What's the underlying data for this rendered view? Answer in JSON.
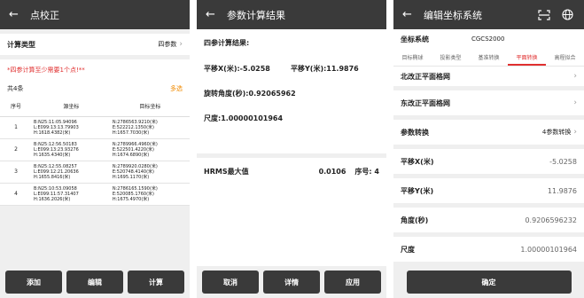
{
  "panel1": {
    "title": "点校正",
    "calc_type_label": "计算类型",
    "calc_type_value": "四参数",
    "warning": "*四参计算至少需要1个点!**",
    "count": "共4条",
    "multiselect": "多选",
    "columns": [
      "序号",
      "源坐标",
      "目标坐标"
    ],
    "rows": [
      {
        "num": "1",
        "src1": "B:N25:11:05.94096",
        "src2": "L:E099:13:13.79903",
        "src3": "H:1618.4382(米)",
        "dst1": "N:2786563.9210(米)",
        "dst2": "E:522212.1350(米)",
        "dst3": "H:1657.7030(米)"
      },
      {
        "num": "2",
        "src1": "B:N25:12:56.50183",
        "src2": "L:E099:13:23.93276",
        "src3": "H:1635.4340(米)",
        "dst1": "N:2789966.4960(米)",
        "dst2": "E:522501.4220(米)",
        "dst3": "H:1674.6890(米)"
      },
      {
        "num": "3",
        "src1": "B:N25:12:55.08257",
        "src2": "L:E099:12:21.20636",
        "src3": "H:1655.8416(米)",
        "dst1": "N:2789920.0280(米)",
        "dst2": "E:520748.4140(米)",
        "dst3": "H:1695.1170(米)"
      },
      {
        "num": "4",
        "src1": "B:N25:10:53.09058",
        "src2": "L:E099:11:57.31407",
        "src3": "H:1636.2026(米)",
        "dst1": "N:2786165.1590(米)",
        "dst2": "E:520085.1760(米)",
        "dst3": "H:1675.4970(米)"
      }
    ],
    "buttons": [
      "添加",
      "编辑",
      "计算"
    ]
  },
  "panel2": {
    "title": "参数计算结果",
    "heading": "四参计算结果:",
    "shift_x": "平移X(米):-5.0258",
    "shift_y": "平移Y(米):11.9876",
    "rotation": "旋转角度(秒):0.92065962",
    "scale": "尺度:1.00000101964",
    "hrms_label": "HRMS最大值",
    "hrms_value": "0.0106",
    "hrms_num": "序号: 4",
    "buttons": [
      "取消",
      "详情",
      "应用"
    ]
  },
  "panel3": {
    "title": "编辑坐标系统",
    "cs_label": "坐标系统",
    "cs_value": "CGCS2000",
    "tabs": [
      "目标椭球",
      "投影类型",
      "基准转换",
      "平面转换",
      "高程拟合"
    ],
    "active_tab": 3,
    "north_grid": "北改正平面格网",
    "east_grid": "东改正平面格网",
    "param_conv_label": "参数转换",
    "param_conv_value": "4参数转换",
    "tx_label": "平移X(米)",
    "tx_value": "-5.0258",
    "ty_label": "平移Y(米)",
    "ty_value": "11.9876",
    "angle_label": "角度(秒)",
    "angle_value": "0.9206596232",
    "scale_label": "尺度",
    "scale_value": "1.00000101964",
    "confirm": "确定"
  }
}
